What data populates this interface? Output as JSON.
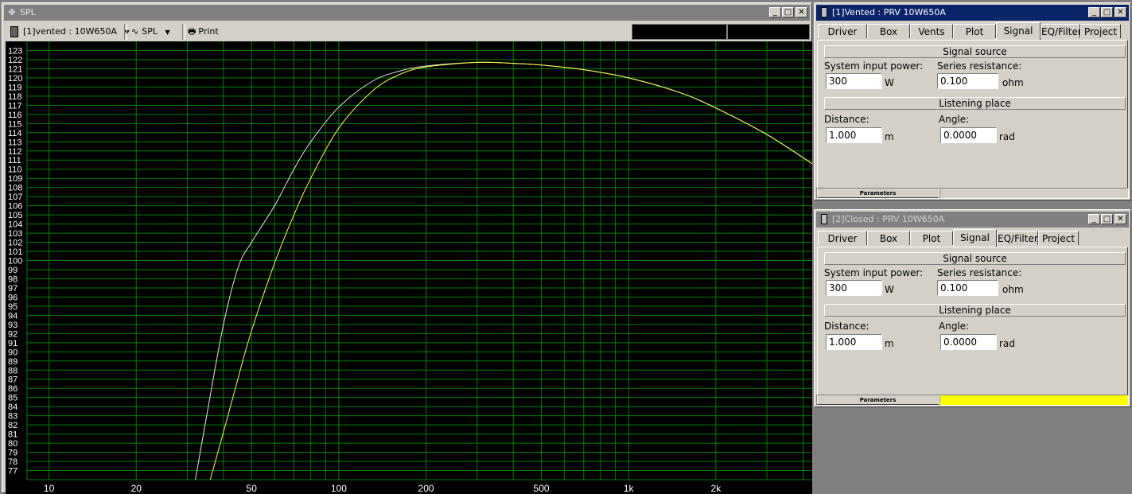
{
  "spl_window": {
    "title": "SPL",
    "toolbar": {
      "project": "[1]vented : 10W650A",
      "plot_type": "SPL",
      "print": "Print"
    }
  },
  "chart_data": {
    "type": "line",
    "x_scale": "log",
    "xlim": [
      8.4,
      4300
    ],
    "ylim": [
      76,
      124
    ],
    "x_ticks": [
      "10",
      "20",
      "50",
      "100",
      "200",
      "500",
      "1k",
      "2k"
    ],
    "x_tick_values": [
      10,
      20,
      50,
      100,
      200,
      500,
      1000,
      2000
    ],
    "y_ticks": [
      "77",
      "78",
      "79",
      "80",
      "81",
      "82",
      "83",
      "84",
      "85",
      "86",
      "87",
      "88",
      "89",
      "90",
      "91",
      "92",
      "93",
      "94",
      "95",
      "96",
      "97",
      "98",
      "99",
      "100",
      "101",
      "102",
      "103",
      "104",
      "105",
      "106",
      "107",
      "108",
      "109",
      "110",
      "111",
      "112",
      "113",
      "114",
      "115",
      "116",
      "117",
      "118",
      "119",
      "120",
      "121",
      "122",
      "123"
    ],
    "grid": true,
    "colors": {
      "background": "#000000",
      "grid": "#008000",
      "text": "#ffffff"
    },
    "series": [
      {
        "color": "#e8e8e8",
        "x": [
          32,
          35,
          40,
          45,
          50,
          60,
          70,
          80,
          100,
          130,
          160,
          200,
          300,
          400,
          500,
          700,
          1000,
          1500,
          2000,
          3000,
          4300
        ],
        "y": [
          76,
          83,
          93,
          99.3,
          102,
          106,
          110,
          113,
          116.8,
          119.6,
          120.7,
          121.3,
          121.7,
          121.6,
          121.4,
          120.9,
          120,
          118.4,
          116.7,
          113.8,
          110.6
        ]
      },
      {
        "color": "#ffff40",
        "x": [
          36,
          40,
          45,
          50,
          60,
          70,
          80,
          100,
          130,
          160,
          200,
          300,
          400,
          500,
          700,
          1000,
          1500,
          2000,
          3000,
          4300
        ],
        "y": [
          76,
          81.2,
          87.2,
          92.3,
          99.7,
          105,
          109,
          114.5,
          118.5,
          120.3,
          121.2,
          121.7,
          121.6,
          121.4,
          120.9,
          120,
          118.4,
          116.7,
          113.8,
          110.6
        ]
      }
    ]
  },
  "panels": [
    {
      "title": "[1]Vented : PRV 10W650A",
      "tabs": [
        "Driver",
        "Box",
        "Vents",
        "Plot",
        "Signal",
        "EQ/Filter",
        "Project"
      ],
      "selected_tab": "Signal",
      "signal_source": "Signal source",
      "system_input_power_label": "System input power:",
      "system_input_power": "300",
      "power_unit": "W",
      "series_resistance_label": "Series resistance:",
      "series_resistance": "0.100",
      "resistance_unit": "ohm",
      "listening_place": "Listening place",
      "distance_label": "Distance:",
      "distance": "1.000",
      "distance_unit": "m",
      "angle_label": "Angle:",
      "angle": "0.0000",
      "angle_unit": "rad",
      "status_label": "Parameters",
      "status_color": "#d4d0c8"
    },
    {
      "title": "[2]Closed : PRV 10W650A",
      "tabs": [
        "Driver",
        "Box",
        "Plot",
        "Signal",
        "EQ/Filter",
        "Project"
      ],
      "selected_tab": "Signal",
      "signal_source": "Signal source",
      "system_input_power_label": "System input power:",
      "system_input_power": "300",
      "power_unit": "W",
      "series_resistance_label": "Series resistance:",
      "series_resistance": "0.100",
      "resistance_unit": "ohm",
      "listening_place": "Listening place",
      "distance_label": "Distance:",
      "distance": "1.000",
      "distance_unit": "m",
      "angle_label": "Angle:",
      "angle": "0.0000",
      "angle_unit": "rad",
      "status_label": "Parameters",
      "status_color": "#ffff00"
    }
  ]
}
